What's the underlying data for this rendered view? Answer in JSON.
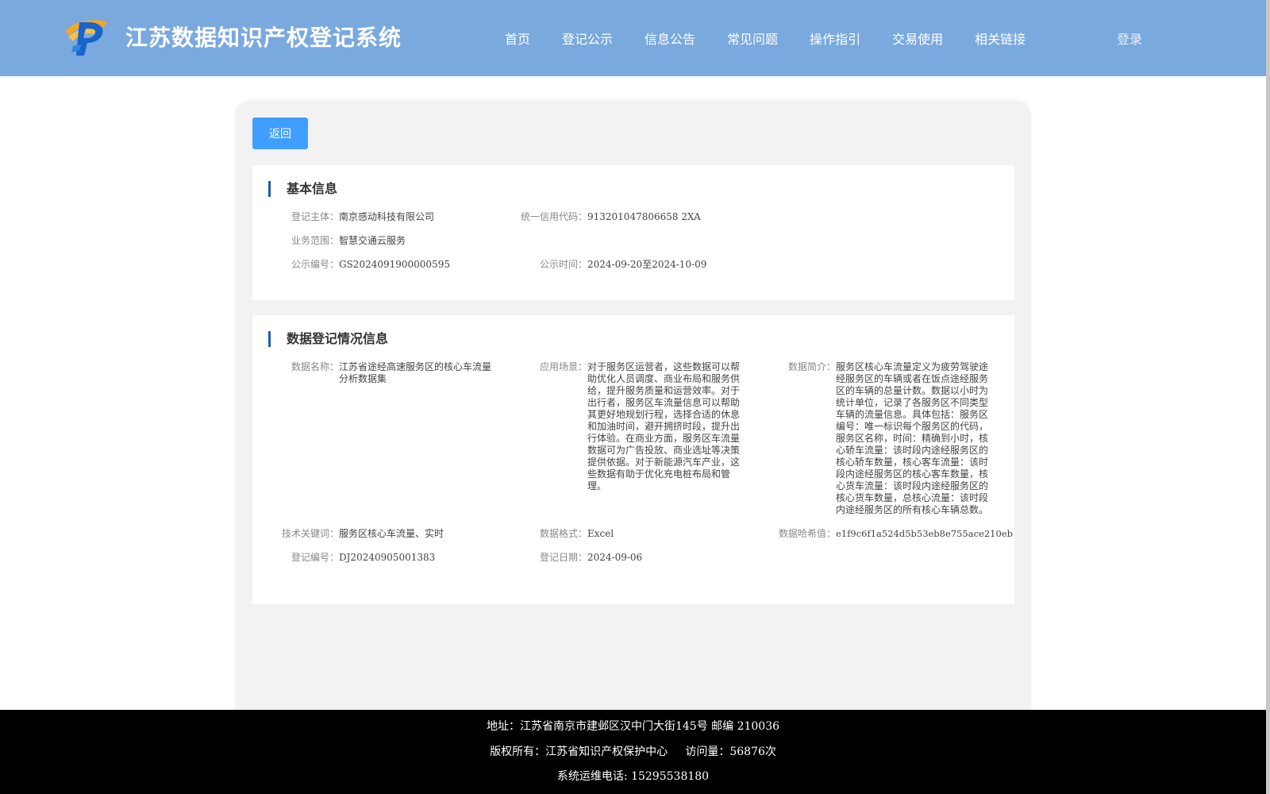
{
  "header": {
    "title": "江苏数据知识产权登记系统",
    "nav": [
      "首页",
      "登记公示",
      "信息公告",
      "常见问题",
      "操作指引",
      "交易使用",
      "相关链接"
    ],
    "login": "登录"
  },
  "back_label": "返回",
  "basic": {
    "title": "基本信息",
    "subject_label": "登记主体：",
    "subject": "南京感动科技有限公司",
    "credit_label": "统一信用代码：",
    "credit": "913201047806658 2XA",
    "scope_label": "业务范围：",
    "scope": "智慧交通云服务",
    "pub_no_label": "公示编号：",
    "pub_no": "GS2024091900000595",
    "pub_time_label": "公示时间：",
    "pub_time": "2024-09-20至2024-10-09"
  },
  "data_info": {
    "title": "数据登记情况信息",
    "name_label": "数据名称：",
    "name": "江苏省途经高速服务区的核心车流量分析数据集",
    "scene_label": "应用场景：",
    "scene": "对于服务区运营者，这些数据可以帮助优化人员调度、商业布局和服务供给，提升服务质量和运营效率。对于出行者，服务区车流量信息可以帮助其更好地规划行程，选择合适的休息和加油时间，避开拥挤时段，提升出行体验。在商业方面，服务区车流量数据可为广告投放、商业选址等决策提供依据。对于新能源汽车产业，这些数据有助于优化充电桩布局和管理。",
    "intro_label": "数据简介：",
    "intro": "服务区核心车流量定义为疲劳驾驶途经服务区的车辆或者在饭点途经服务区的车辆的总量计数。数据以小时为统计单位，记录了各服务区不同类型车辆的流量信息。具体包括：服务区编号：唯一标识每个服务区的代码，服务区名称，时间：精确到小时，核心轿车流量：该时段内途经服务区的核心轿车数量，核心客车流量：该时段内途经服务区的核心客车数量，核心货车流量：该时段内途经服务区的核心货车数量，总核心流量：该时段内途经服务区的所有核心车辆总数。",
    "keywords_label": "技术关键词：",
    "keywords": "服务区核心车流量、实时",
    "format_label": "数据格式：",
    "format": "Excel",
    "hash_label": "数据哈希值：",
    "hash": "e1f9c6f1a524d5b53eb8e755ace210eb",
    "reg_no_label": "登记编号：",
    "reg_no": "DJ20240905001383",
    "reg_date_label": "登记日期：",
    "reg_date": "2024-09-06"
  },
  "footer": {
    "address": "地址：江苏省南京市建邺区汉中门大街145号 邮编 210036",
    "copyright": "版权所有：江苏省知识产权保护中心     访问量：56876次",
    "phone": "系统运维电话: 15295538180"
  },
  "colors": {
    "header_bg": "#7aa9de",
    "button": "#409eff",
    "section_bar": "#1f5fa9",
    "footer_bg": "#000000"
  }
}
